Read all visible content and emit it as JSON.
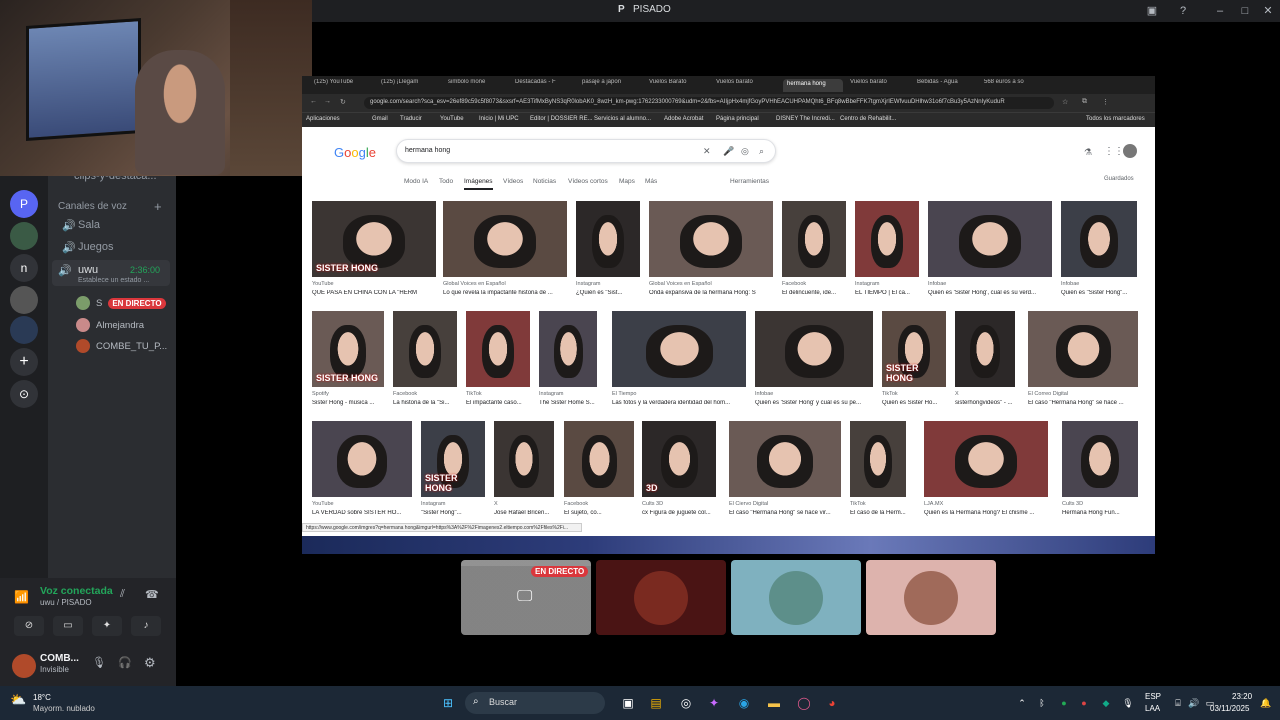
{
  "discord": {
    "window_title": "PISADO",
    "title_initial": "P",
    "channel_partial": "clips-y-destaca...",
    "voice_channels_header": "Canales de voz",
    "voice_channels": [
      "Sala",
      "Juegos",
      "uwu"
    ],
    "active_channel_time": "2:36:00",
    "status_prompt": "Establece un estado ...",
    "members": [
      {
        "name": "S",
        "live": "EN DIRECTO"
      },
      {
        "name": "Almejandra"
      },
      {
        "name": "COMBE_TU_P..."
      }
    ],
    "server_letters": {
      "p": "P",
      "n": "n"
    },
    "voice_connected": "Voz conectada",
    "voice_location": "uwu / PISADO",
    "user_name": "COMB...",
    "user_status": "Invisible"
  },
  "stream": {
    "live_badge": "EN DIRECTO",
    "browser": {
      "tabs": [
        "(125) YouTube",
        "(125) ¡Llegam",
        "simbolo mone",
        "Destacadas - F",
        "pasaje a japon",
        "Vuelos Barato",
        "Vuelos barato",
        "hermana hong",
        "Vuelos barato",
        "Bebidas - Agua",
        "568 euros a so"
      ],
      "url": "google.com/search?sca_esv=26ef89c59c5f8073&sxsrf=AE3TifMxByNS3qR0lobAK0_8wzH_km-pwg:1762233000769&udm=2&fbs=AIIjpHx4mjfGoyPVHhEACUHPAMQht6_BFq8wBbeFFK7tgmXjrIEWfvuuDHlhw31o6f7cBu3y5AzNnIyKuduR",
      "bookmarks": [
        "Aplicaciones",
        "Gmail",
        "Traducir",
        "YouTube",
        "Inicio | Mi UPC",
        "Editor | DOSSIER RE...",
        "Servicios al alumno...",
        "Adobe Acrobat",
        "Página principal",
        "DISNEY The Incredi...",
        "Centro de Rehabilit...",
        "Todos los marcadores"
      ],
      "status_url": "https://www.google.com/imgres?q=hermana hong&imgurl=https%3A%2F%2Fimagenes2.eltiempo.com%2Ffiles%2Fi..."
    },
    "google": {
      "logo": "Google",
      "query": "hermana hong",
      "tabs": [
        "Modo IA",
        "Todo",
        "Imágenes",
        "Vídeos",
        "Noticias",
        "Vídeos cortos",
        "Maps",
        "Más"
      ],
      "tools": "Herramientas",
      "saved": "Guardados",
      "rows": [
        [
          {
            "src": "YouTube",
            "title": "QUÉ PASA EN CHINA CON LA \"HERM"
          },
          {
            "src": "Global Voices en Español",
            "title": "Lo que revela la impactante historia de ..."
          },
          {
            "src": "Instagram",
            "title": "¿Quién es \"Sist..."
          },
          {
            "src": "Global Voices en Español",
            "title": "Onda expansiva de la hermana Hong: S"
          },
          {
            "src": "Facebook",
            "title": "El delincuente, ide..."
          },
          {
            "src": "Instagram",
            "title": "EL TIEMPO | El ca..."
          },
          {
            "src": "Infobae",
            "title": "Quién es 'Sister Hong', cuál es su verd..."
          },
          {
            "src": "Infobae",
            "title": "Quién es \"Sister Hong\"..."
          }
        ],
        [
          {
            "src": "Spotify",
            "title": "Sister Hong - música ..."
          },
          {
            "src": "Facebook",
            "title": "La historia de la \"Si..."
          },
          {
            "src": "TikTok",
            "title": "El impactante caso..."
          },
          {
            "src": "Instagram",
            "title": "The Sister Home S..."
          },
          {
            "src": "El Tiempo",
            "title": "Las fotos y la verdadera identidad del hom..."
          },
          {
            "src": "Infobae",
            "title": "Quién es 'Sister Hong' y cuál es su pe..."
          },
          {
            "src": "TikTok",
            "title": "Quién es Sister Ho..."
          },
          {
            "src": "X",
            "title": "sisterhongvideos\" - ..."
          },
          {
            "src": "El Correo Digital",
            "title": "El caso \"Hermana Hong\" se hace ..."
          }
        ],
        [
          {
            "src": "YouTube",
            "title": "LA VERDAD sobre SISTER HO..."
          },
          {
            "src": "Instagram",
            "title": "\"Sister Hong\"..."
          },
          {
            "src": "X",
            "title": "José Rafael Briceñ..."
          },
          {
            "src": "Facebook",
            "title": "El sujeto, co..."
          },
          {
            "src": "Cults 3D",
            "title": "cx Figura de juguete col..."
          },
          {
            "src": "El Ciervo Digital",
            "title": "El caso \"Hermana Hong\" se hace vir..."
          },
          {
            "src": "TikTok",
            "title": "El caso de la Herm..."
          },
          {
            "src": "LJA.MX",
            "title": "Quién es la Hermana Hong? El chisme ..."
          },
          {
            "src": "Cults 3D",
            "title": "Hermana Hong Fun..."
          }
        ]
      ],
      "overlay_texts": [
        "SISTER HONG",
        "SISTER HONG",
        "SISTER HONG",
        "SISTER HONG",
        "3D"
      ]
    }
  },
  "taskbar": {
    "weather_temp": "18°C",
    "weather_desc": "Mayorm. nublado",
    "search": "Buscar",
    "lang1": "ESP",
    "lang2": "LAA",
    "time": "23:20",
    "date": "03/11/2025"
  }
}
